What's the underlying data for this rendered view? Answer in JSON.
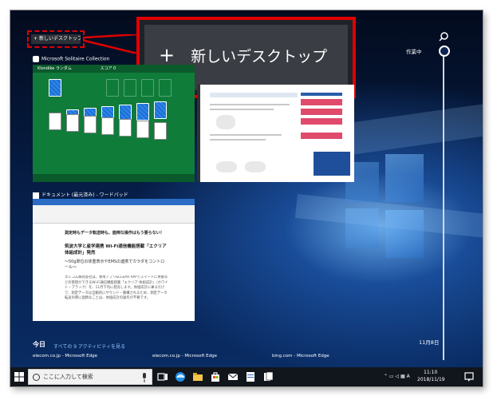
{
  "new_desktop": {
    "label": "新しいデスクトップ",
    "plus": "+"
  },
  "timeline": {
    "now_label": "作業中",
    "date_label": "11月8日"
  },
  "windows": [
    {
      "title": "Microsoft Solitaire Collection"
    },
    {
      "title": "ドキュメント (最元済み) - ワードパッド"
    }
  ],
  "solitaire": {
    "toolbar": "Klondike  ランダム",
    "score": "スコア 0"
  },
  "wordpad": {
    "headline": "測定時もデータ転送時も、面倒な操作はもう要らない！",
    "subtitle": "筑波大学と産学連携 Wi-Fi通信機能搭載「エクリア 体組成計」発売",
    "lead": "～50g単位の体重表示やEMSの連携でカラダをコントロール～",
    "body": "エレコム株式会社は、専用アプリECLEAR APPでスマートに体重などの管理ができるWi-Fi通信機能搭載「エクリア 体組成計」（ホワイト・ブラック）を、11月下旬に発売します。体組成計に乗るだけで、測定データは自動的にサウンド・繋構されるため、測定データ転送の際に面倒なことは、体組成計の操作が不要です。"
  },
  "today": {
    "label": "今日",
    "link": "すべての 9 アクティビティを見る"
  },
  "activities": [
    "elecom.co.jp - Microsoft Edge",
    "elecom.co.jp - Microsoft Edge",
    "bing.com - Microsoft Edge"
  ],
  "taskbar": {
    "search_placeholder": "ここに入力して検索",
    "time": "11:10",
    "date": "2018/11/19"
  },
  "colors": {
    "highlight": "#e00000",
    "desktop": "#06204d"
  }
}
